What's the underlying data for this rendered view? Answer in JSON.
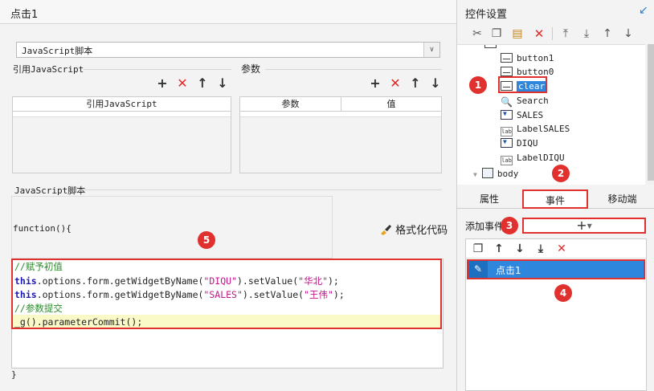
{
  "dialog": {
    "title": "点击1"
  },
  "script_type": {
    "selected": "JavaScript脚本"
  },
  "ref_js": {
    "label": "引用JavaScript",
    "column": "引用JavaScript"
  },
  "params": {
    "label": "参数",
    "col_name": "参数",
    "col_value": "值"
  },
  "js_script": {
    "label": "JavaScript脚本",
    "function_head": "function(){",
    "format_button": "格式化代码",
    "function_end": "}",
    "code_lines": [
      {
        "parts": [
          "//赋予初值"
        ]
      },
      {
        "parts": [
          "this",
          ".options.form.getWidgetByName(",
          "\"DIQU\"",
          ").setValue(",
          "\"华北\"",
          ");"
        ]
      },
      {
        "parts": [
          "this",
          ".options.form.getWidgetByName(",
          "\"SALES\"",
          ").setValue(",
          "\"王伟\"",
          ");"
        ]
      },
      {
        "parts": [
          "//参数提交"
        ]
      },
      {
        "parts": [
          "_g().parameterCommit();"
        ]
      }
    ]
  },
  "toolbar_icons": {
    "add": "+",
    "delete": "✕",
    "up": "↑",
    "down": "↓"
  },
  "right_panel": {
    "title": "控件设置",
    "tree": {
      "nodes": [
        {
          "label": "button1",
          "icon": "button-icon"
        },
        {
          "label": "button0",
          "icon": "button-icon"
        },
        {
          "label": "clear",
          "icon": "button-icon",
          "selected": true
        },
        {
          "label": "Search",
          "icon": "search-icon"
        },
        {
          "label": "SALES",
          "icon": "combo-icon"
        },
        {
          "label": "LabelSALES",
          "icon": "label-icon"
        },
        {
          "label": "DIQU",
          "icon": "combo-icon"
        },
        {
          "label": "LabelDIQU",
          "icon": "label-icon"
        },
        {
          "label": "body",
          "icon": "body-icon"
        }
      ],
      "label_icon_text": "lab"
    },
    "tabs": [
      "属性",
      "事件",
      "移动端"
    ],
    "active_tab": "事件",
    "add_event_label": "添加事件",
    "add_event_button": "+",
    "events": [
      {
        "label": "点击1"
      }
    ]
  },
  "badges": [
    "1",
    "2",
    "3",
    "4",
    "5"
  ],
  "colors": {
    "accent": "#2f86dd",
    "highlight": "#e03030",
    "delete": "#e12a2a"
  }
}
